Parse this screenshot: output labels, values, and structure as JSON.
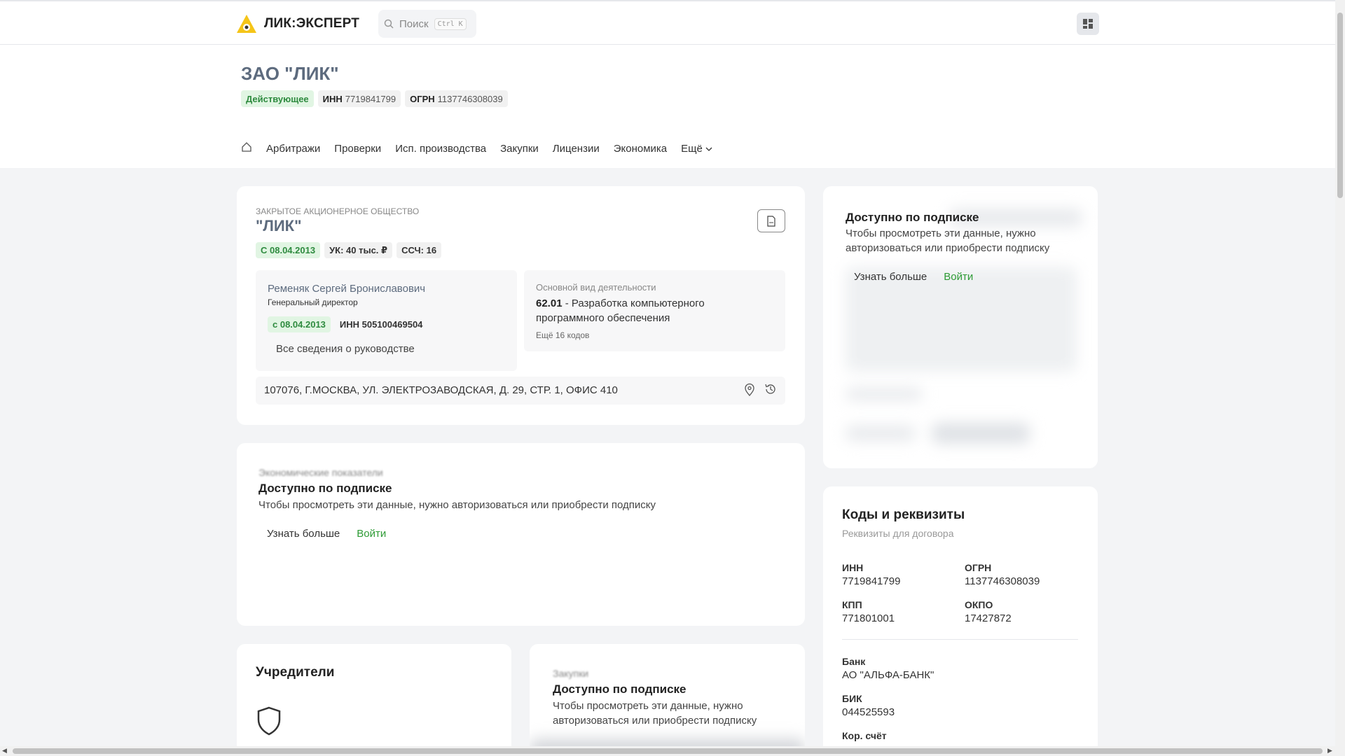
{
  "header": {
    "logo_text": "ЛИК:ЭКСПЕРТ",
    "search_placeholder": "Поиск",
    "search_shortcut": "Ctrl K"
  },
  "company": {
    "title": "ЗАО \"ЛИК\"",
    "status": "Действующее",
    "inn_label": "ИНН",
    "inn": "7719841799",
    "ogrn_label": "ОГРН",
    "ogrn": "1137746308039"
  },
  "nav": {
    "items": [
      "Арбитражи",
      "Проверки",
      "Исп. производства",
      "Закупки",
      "Лицензии",
      "Экономика"
    ],
    "more": "Ещё"
  },
  "main_card": {
    "legal_form": "ЗАКРЫТОЕ АКЦИОНЕРНОЕ ОБЩЕСТВО",
    "short_name": "\"ЛИК\"",
    "chips": [
      "С 08.04.2013",
      "УК: 40 тыс. ₽",
      "ССЧ: 16"
    ],
    "head": {
      "name": "Ременяк Сергей Брониславович",
      "role": "Генеральный директор",
      "since": "с 08.04.2013",
      "inn": "ИНН 505100469504",
      "link": "Все сведения о руководстве"
    },
    "activity": {
      "caption": "Основной вид деятельности",
      "code": "62.01",
      "text": " - Разработка компьютерного программного обеспечения",
      "more": "Ещё 16 кодов"
    },
    "address": "107076, Г.МОСКВА, УЛ. ЭЛЕКТРОЗАВОДСКАЯ, Д. 29, СТР. 1, ОФИС 410"
  },
  "econ_card": {
    "caption": "Экономические показатели",
    "title": "Доступно по подписке",
    "text": "Чтобы просмотреть эти данные, нужно авторизоваться или приобрести подписку",
    "learn_more": "Узнать больше",
    "login": "Войти"
  },
  "founders_card": {
    "title": "Учредители"
  },
  "purchases_card": {
    "caption": "Закупки",
    "title": "Доступно по подписке",
    "text": "Чтобы просмотреть эти данные, нужно авторизоваться или приобрести подписку"
  },
  "subscription_card": {
    "title": "Доступно по подписке",
    "text": "Чтобы просмотреть эти данные, нужно авторизоваться или приобрести подписку",
    "learn_more": "Узнать больше",
    "login": "Войти"
  },
  "codes_card": {
    "title": "Коды и реквизиты",
    "subtitle": "Реквизиты для договора",
    "inn_label": "ИНН",
    "inn": "7719841799",
    "ogrn_label": "ОГРН",
    "ogrn": "1137746308039",
    "kpp_label": "КПП",
    "kpp": "771801001",
    "okpo_label": "ОКПО",
    "okpo": "17427872",
    "bank_label": "Банк",
    "bank": "АО \"АЛЬФА-БАНК\"",
    "bik_label": "БИК",
    "bik": "044525593",
    "corr_label": "Кор. счёт"
  },
  "colors": {
    "accent_green": "#2e9b35",
    "title_slate": "#5d6b7e",
    "background": "#f3f4f6"
  }
}
